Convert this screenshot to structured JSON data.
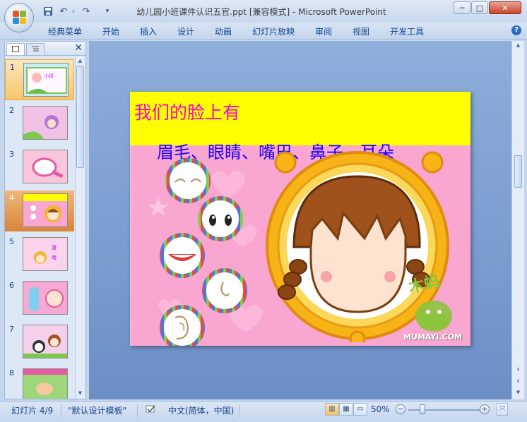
{
  "window": {
    "title": "幼儿园小班课件认识五官.ppt [兼容模式] - Microsoft PowerPoint",
    "minimize": "─",
    "maximize": "□",
    "close": "✕"
  },
  "quick_access": {
    "save_icon": "save-icon",
    "undo_icon": "undo-icon",
    "redo_icon": "redo-icon",
    "customize_icon": "customize-icon"
  },
  "ribbon": {
    "tabs": [
      "经典菜单",
      "开始",
      "插入",
      "设计",
      "动画",
      "幻灯片放映",
      "审阅",
      "视图",
      "开发工具"
    ],
    "help": "?"
  },
  "pane": {
    "close": "✕",
    "slides": [
      "1",
      "2",
      "3",
      "4",
      "5",
      "6",
      "7",
      "8"
    ],
    "selected_slide": "4"
  },
  "slide": {
    "title": "我们的脸上有",
    "subtitle": "眉毛、眼睛、嘴巴、鼻子、耳朵",
    "watermark": "MUMAYI.COM"
  },
  "status": {
    "slide_pos": "幻灯片 4/9",
    "theme": "\"默认设计模板\"",
    "language": "中文(简体，中国)",
    "zoom": "50%",
    "zoom_level": 0.5
  },
  "colors": {
    "title": "#ff00cc",
    "subtitle": "#1d00ff",
    "band": "#ffff00",
    "slide_bg": "#f9a6d0"
  }
}
